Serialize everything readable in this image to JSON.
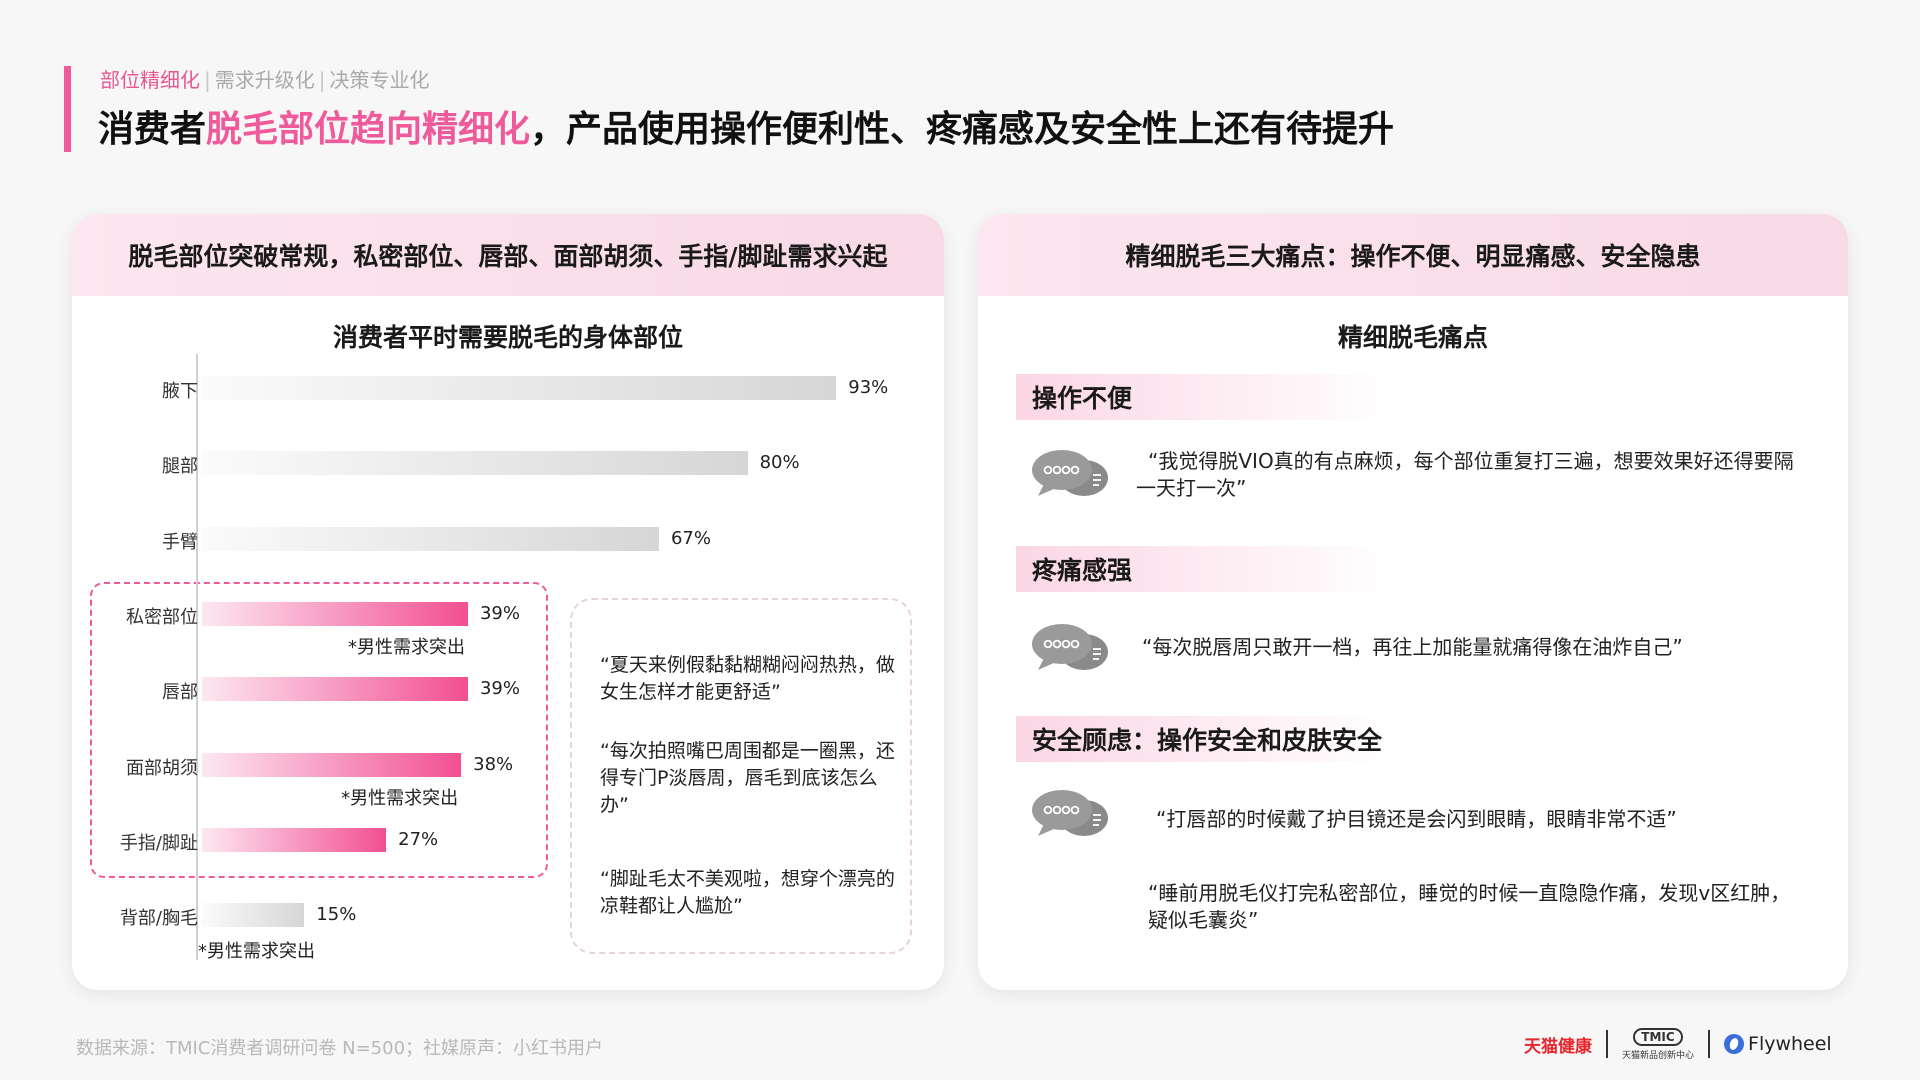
{
  "header": {
    "crumbs": [
      "部位精细化",
      "需求升级化",
      "决策专业化"
    ],
    "separator": "|",
    "title_pre": "消费者",
    "title_hl": "脱毛部位趋向精细化",
    "title_post": "，产品使用操作便利性、疼痛感及安全性上还有待提升"
  },
  "left_panel": {
    "heading": "脱毛部位突破常规，私密部位、唇部、面部胡须、手指/脚趾需求兴起",
    "quotes": [
      "“夏天来例假黏黏糊糊闷闷热热，做女生怎样才能更舒适”",
      "“每次拍照嘴巴周围都是一圈黑，还得专门P淡唇周，唇毛到底该怎么办”",
      "“脚趾毛太不美观啦，想穿个漂亮的凉鞋都让人尴尬”"
    ],
    "male_note": "*男性需求突出"
  },
  "chart_data": {
    "type": "bar",
    "orientation": "horizontal",
    "title": "消费者平时需要脱毛的身体部位",
    "categories": [
      "腋下",
      "腿部",
      "手臂",
      "私密部位",
      "唇部",
      "面部胡须",
      "手指/脚趾",
      "背部/胸毛"
    ],
    "values": [
      93,
      80,
      67,
      39,
      39,
      38,
      27,
      15
    ],
    "unit": "%",
    "value_labels": [
      "93%",
      "80%",
      "67%",
      "39%",
      "39%",
      "38%",
      "27%",
      "15%"
    ],
    "highlighted": [
      false,
      false,
      false,
      true,
      true,
      true,
      true,
      false
    ],
    "male_emphasis": [
      false,
      false,
      false,
      true,
      false,
      true,
      false,
      true
    ],
    "xlim": [
      0,
      100
    ],
    "colors": {
      "highlight": "#f24f92",
      "normal": "#d6d6d6"
    }
  },
  "right_panel": {
    "heading": "精细脱毛三大痛点：操作不便、明显痛感、安全隐患",
    "subtitle": "精细脱毛痛点",
    "sections": [
      {
        "tag": "操作不便",
        "quotes": [
          "“我觉得脱VIO真的有点麻烦，每个部位重复打三遍，想要效果好还得要隔一天打一次”"
        ]
      },
      {
        "tag": "疼痛感强",
        "quotes": [
          "“每次脱唇周只敢开一档，再往上加能量就痛得像在油炸自己”"
        ]
      },
      {
        "tag": "安全顾虑：操作安全和皮肤安全",
        "quotes": [
          "“打唇部的时候戴了护目镜还是会闪到眼睛，眼睛非常不适”",
          "“睡前用脱毛仪打完私密部位，睡觉的时候一直隐隐作痛，发现v区红肿，疑似毛囊炎”"
        ]
      }
    ]
  },
  "footer": {
    "source": "数据来源：TMIC消费者调研问卷 N=500；社媒原声：小红书用户",
    "logo_tmall": "天猫健康",
    "logo_tmic": "TMIC",
    "logo_tmic_sub": "天猫新品创新中心",
    "logo_flywheel": "Flywheel"
  },
  "colors": {
    "accent": "#ee5a9a",
    "panel_header": "#fce6ef"
  }
}
